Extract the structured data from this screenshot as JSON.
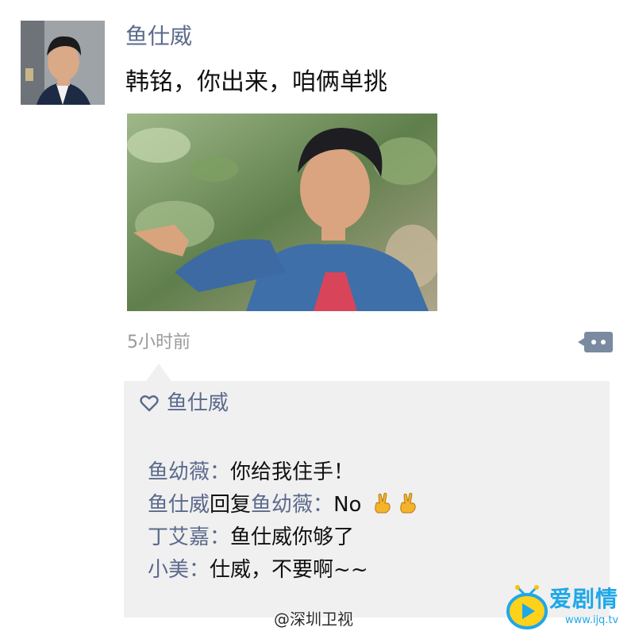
{
  "post": {
    "author_name": "鱼仕威",
    "text": "韩铭，你出来，咱俩单挑",
    "timestamp": "5小时前"
  },
  "likes": {
    "names": "鱼仕威"
  },
  "comments": [
    {
      "nick": "鱼幼薇",
      "separator": "：",
      "text": "你给我住手！"
    },
    {
      "nick": "鱼仕威",
      "reply_word": "回复",
      "reply_to": "鱼幼薇",
      "separator": "：",
      "text": "No"
    },
    {
      "nick": "丁艾嘉",
      "separator": "：",
      "text": "鱼仕威你够了"
    },
    {
      "nick": "小美",
      "separator": "：",
      "text": "仕威，不要啊~~"
    }
  ],
  "watermark": {
    "weibo": "@深圳卫视",
    "logo_text": "爱剧情",
    "logo_url": "www.ijq.tv"
  },
  "colors": {
    "nickname": "#5b6a8c",
    "comment_bg": "#f0f0f0",
    "more_button": "#7a8aa0",
    "logo": "#1fa7e8"
  }
}
